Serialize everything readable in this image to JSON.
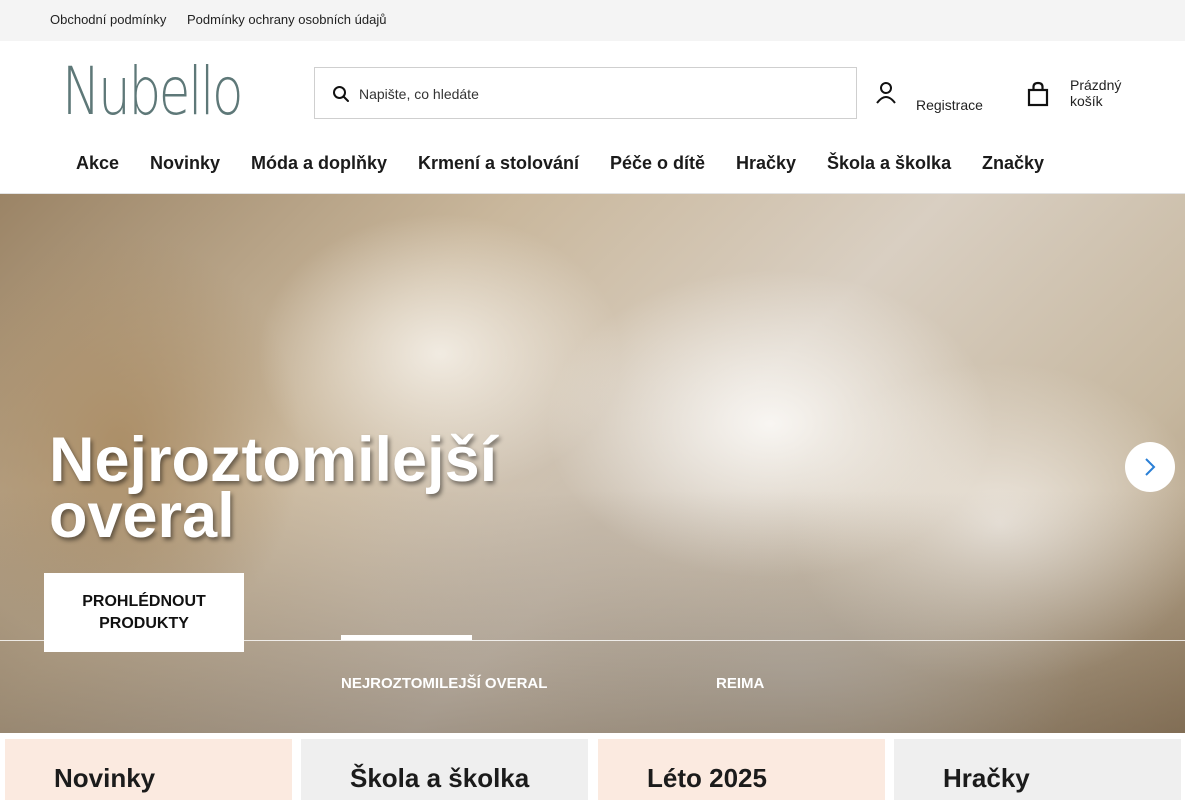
{
  "topbar": {
    "links": [
      "Obchodní podmínky",
      "Podmínky ochrany osobních údajů"
    ]
  },
  "header": {
    "logo": "Nubello",
    "search_placeholder": "Napište, co hledáte",
    "registration": "Registrace",
    "cart_label": "Prázdný košík"
  },
  "nav": {
    "items": [
      "Akce",
      "Novinky",
      "Móda a doplňky",
      "Krmení a stolování",
      "Péče o dítě",
      "Hračky",
      "Škola a školka",
      "Značky"
    ]
  },
  "hero": {
    "title": "Nejroztomilejší overal",
    "cta": "PROHLÉDNOUT PRODUKTY",
    "slides": [
      "NEJROZTOMILEJŠÍ OVERAL",
      "REIMA"
    ],
    "active_slide": 0
  },
  "categories": [
    "Novinky",
    "Škola a školka",
    "Léto 2025",
    "Hračky"
  ],
  "colors": {
    "logo": "#5e7878",
    "topbar_bg": "#f4f4f4",
    "category_peach": "#fbeae0",
    "category_gray": "#efefef"
  },
  "icons": [
    "search-icon",
    "user-icon",
    "shopping-bag-icon",
    "chevron-right-icon"
  ]
}
